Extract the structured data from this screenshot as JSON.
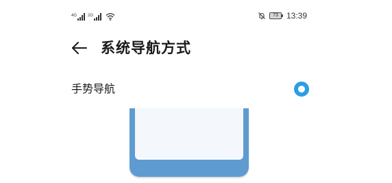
{
  "status_bar": {
    "network_1": "4G",
    "network_2": "2G",
    "battery_level": "73",
    "time": "13:39",
    "icons": [
      "signal-icon",
      "wifi-icon",
      "mute-icon",
      "battery-icon"
    ]
  },
  "header": {
    "back_icon": "back-arrow-icon",
    "title": "系统导航方式"
  },
  "options": [
    {
      "label": "手势导航",
      "selected": true
    }
  ],
  "colors": {
    "accent": "#2b9ee4",
    "preview_frame": "#5e9bd1",
    "preview_screen": "#f4f8fc"
  }
}
